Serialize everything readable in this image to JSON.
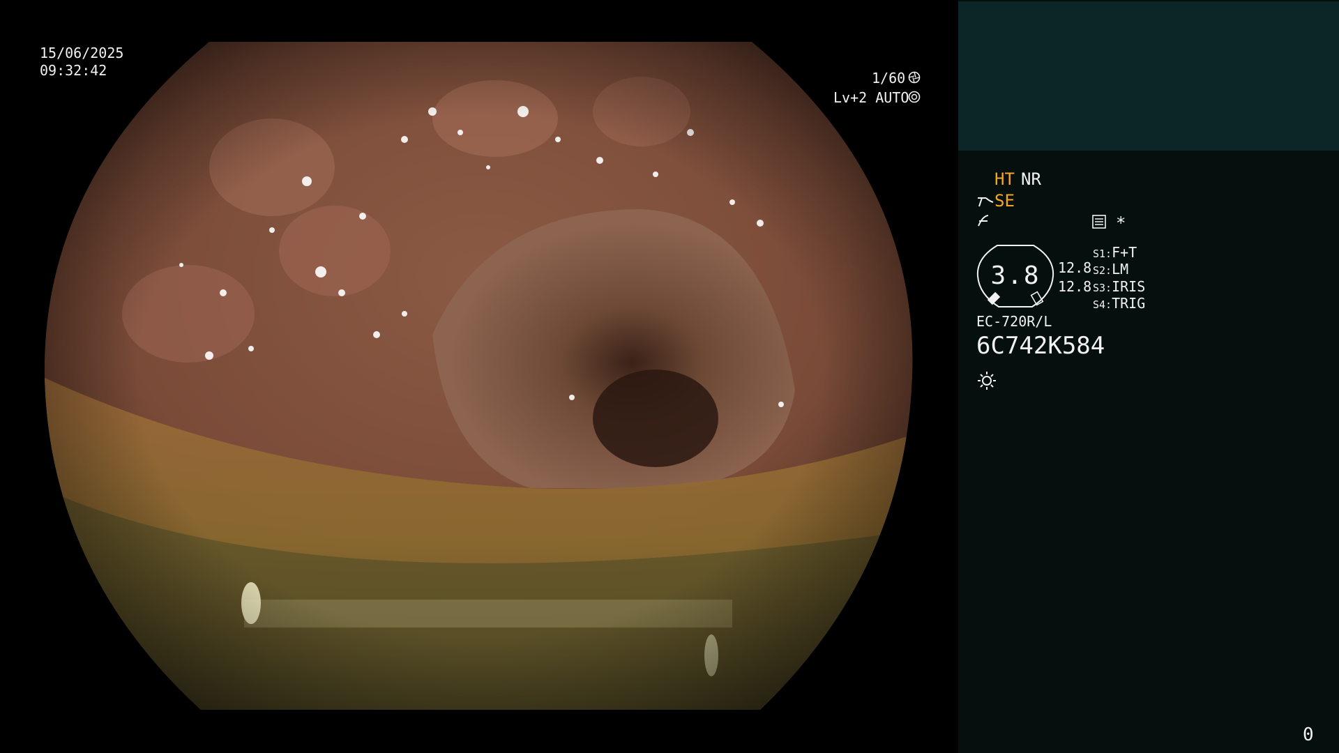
{
  "overlay": {
    "date": "15/06/2025",
    "time": "09:32:42",
    "shutter": "1/60",
    "level": "Lv+2 AUTO"
  },
  "panel": {
    "ht": "HT",
    "nr": "NR",
    "se": "SE",
    "star": "*",
    "gauge_value": "3.8",
    "left_values": [
      "12.8",
      "12.8"
    ],
    "switches": [
      {
        "label": "S1:",
        "value": "F+T"
      },
      {
        "label": "S2:",
        "value": "LM"
      },
      {
        "label": "S3:",
        "value": "IRIS"
      },
      {
        "label": "S4:",
        "value": "TRIG"
      }
    ],
    "model": "EC-720R/L",
    "serial": "6C742K584",
    "counter": "0"
  },
  "colors": {
    "amber": "#f5a623",
    "panel_bg": "#040f0e",
    "panel_top": "#0c2527"
  },
  "icons": [
    "shutter-icon",
    "auto-iris-icon",
    "tool-icon",
    "structure-icon",
    "menu-card-icon",
    "brightness-icon"
  ]
}
